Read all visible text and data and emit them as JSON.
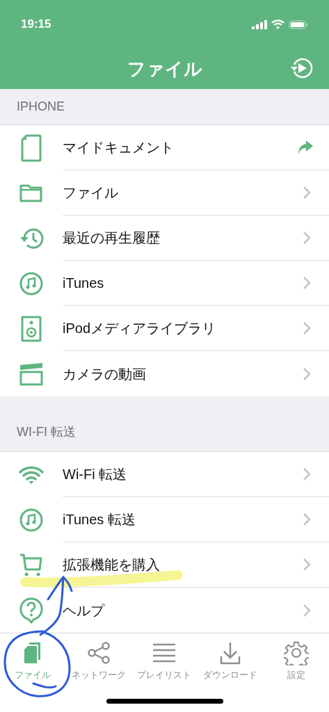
{
  "status_bar": {
    "time": "19:15"
  },
  "nav": {
    "title": "ファイル"
  },
  "sections": [
    {
      "header": "IPHONE",
      "items": [
        {
          "label": "マイドキュメント"
        },
        {
          "label": "ファイル"
        },
        {
          "label": "最近の再生履歴"
        },
        {
          "label": "iTunes"
        },
        {
          "label": "iPodメディアライブラリ"
        },
        {
          "label": "カメラの動画"
        }
      ]
    },
    {
      "header": "WI-FI 転送",
      "items": [
        {
          "label": "Wi-Fi 転送"
        },
        {
          "label": "iTunes 転送"
        },
        {
          "label": "拡張機能を購入"
        },
        {
          "label": "ヘルプ"
        }
      ]
    }
  ],
  "tabs": [
    {
      "label": "ファイル",
      "selected": true
    },
    {
      "label": "ネットワーク",
      "selected": false
    },
    {
      "label": "プレイリスト",
      "selected": false
    },
    {
      "label": "ダウンロード",
      "selected": false
    },
    {
      "label": "設定",
      "selected": false
    }
  ]
}
